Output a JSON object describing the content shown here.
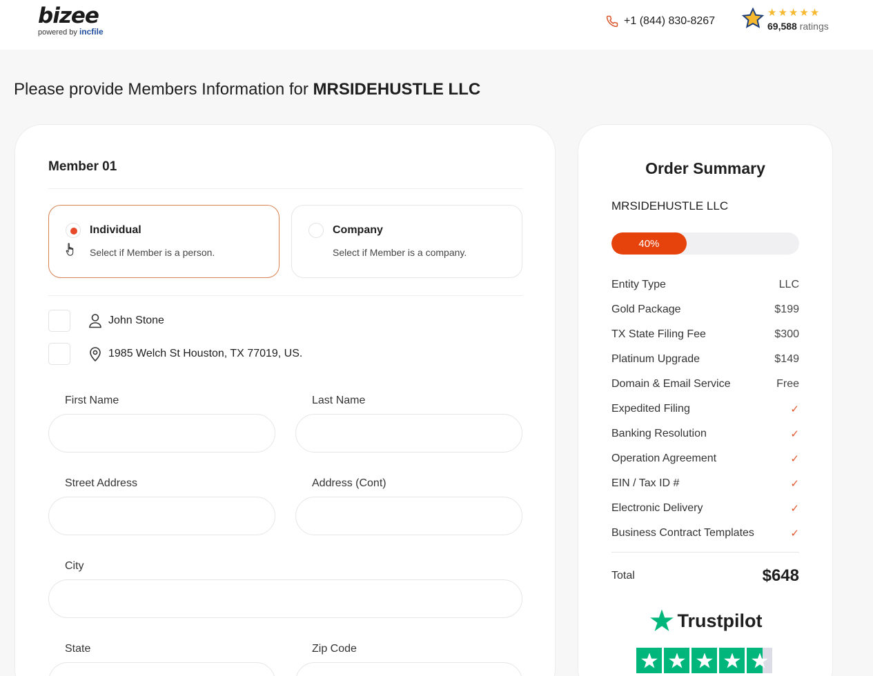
{
  "header": {
    "logo_word": "bizee",
    "logo_powered": "powered by",
    "logo_brand": "incfile",
    "phone": "+1 (844) 830-8267",
    "rating_count": "69,588",
    "rating_suffix": "ratings",
    "rating_stars": "★★★★★",
    "colors": {
      "star": "#f5b82e",
      "brand_blue": "#1f4e9c"
    }
  },
  "page": {
    "title_prefix": "Please provide Members Information for",
    "company": "MRSIDEHUSTLE LLC"
  },
  "member": {
    "heading": "Member 01",
    "types": [
      {
        "label": "Individual",
        "desc": "Select if Member is a person.",
        "selected": true
      },
      {
        "label": "Company",
        "desc": "Select if Member is a company.",
        "selected": false
      }
    ],
    "saved": [
      {
        "icon": "person-icon",
        "text": "John Stone"
      },
      {
        "icon": "location-pin-icon",
        "text": "1985 Welch St Houston, TX 77019, US."
      }
    ],
    "fields": {
      "first_name": {
        "label": "First Name",
        "value": ""
      },
      "last_name": {
        "label": "Last Name",
        "value": ""
      },
      "street": {
        "label": "Street Address",
        "value": ""
      },
      "address_cont": {
        "label": "Address (Cont)",
        "value": ""
      },
      "city": {
        "label": "City",
        "value": ""
      },
      "state": {
        "label": "State",
        "value": ""
      },
      "zip": {
        "label": "Zip Code",
        "value": ""
      }
    }
  },
  "summary": {
    "title": "Order Summary",
    "company": "MRSIDEHUSTLE LLC",
    "progress_label": "40%",
    "progress_value": 0.4,
    "accent": "#e5420c",
    "items": [
      {
        "label": "Entity Type",
        "value": "LLC"
      },
      {
        "label": "Gold Package",
        "value": "$199"
      },
      {
        "label": "TX State Filing Fee",
        "value": "$300"
      },
      {
        "label": "Platinum Upgrade",
        "value": "$149"
      },
      {
        "label": "Domain & Email Service",
        "value": "Free"
      },
      {
        "label": "Expedited Filing",
        "value": "✓"
      },
      {
        "label": "Banking Resolution",
        "value": "✓"
      },
      {
        "label": "Operation Agreement",
        "value": "✓"
      },
      {
        "label": "EIN / Tax ID #",
        "value": "✓"
      },
      {
        "label": "Electronic Delivery",
        "value": "✓"
      },
      {
        "label": "Business Contract Templates",
        "value": "✓"
      }
    ],
    "total_label": "Total",
    "total_value": "$648",
    "trustpilot_word": "Trustpilot",
    "trustpilot_stars": 4.5
  }
}
